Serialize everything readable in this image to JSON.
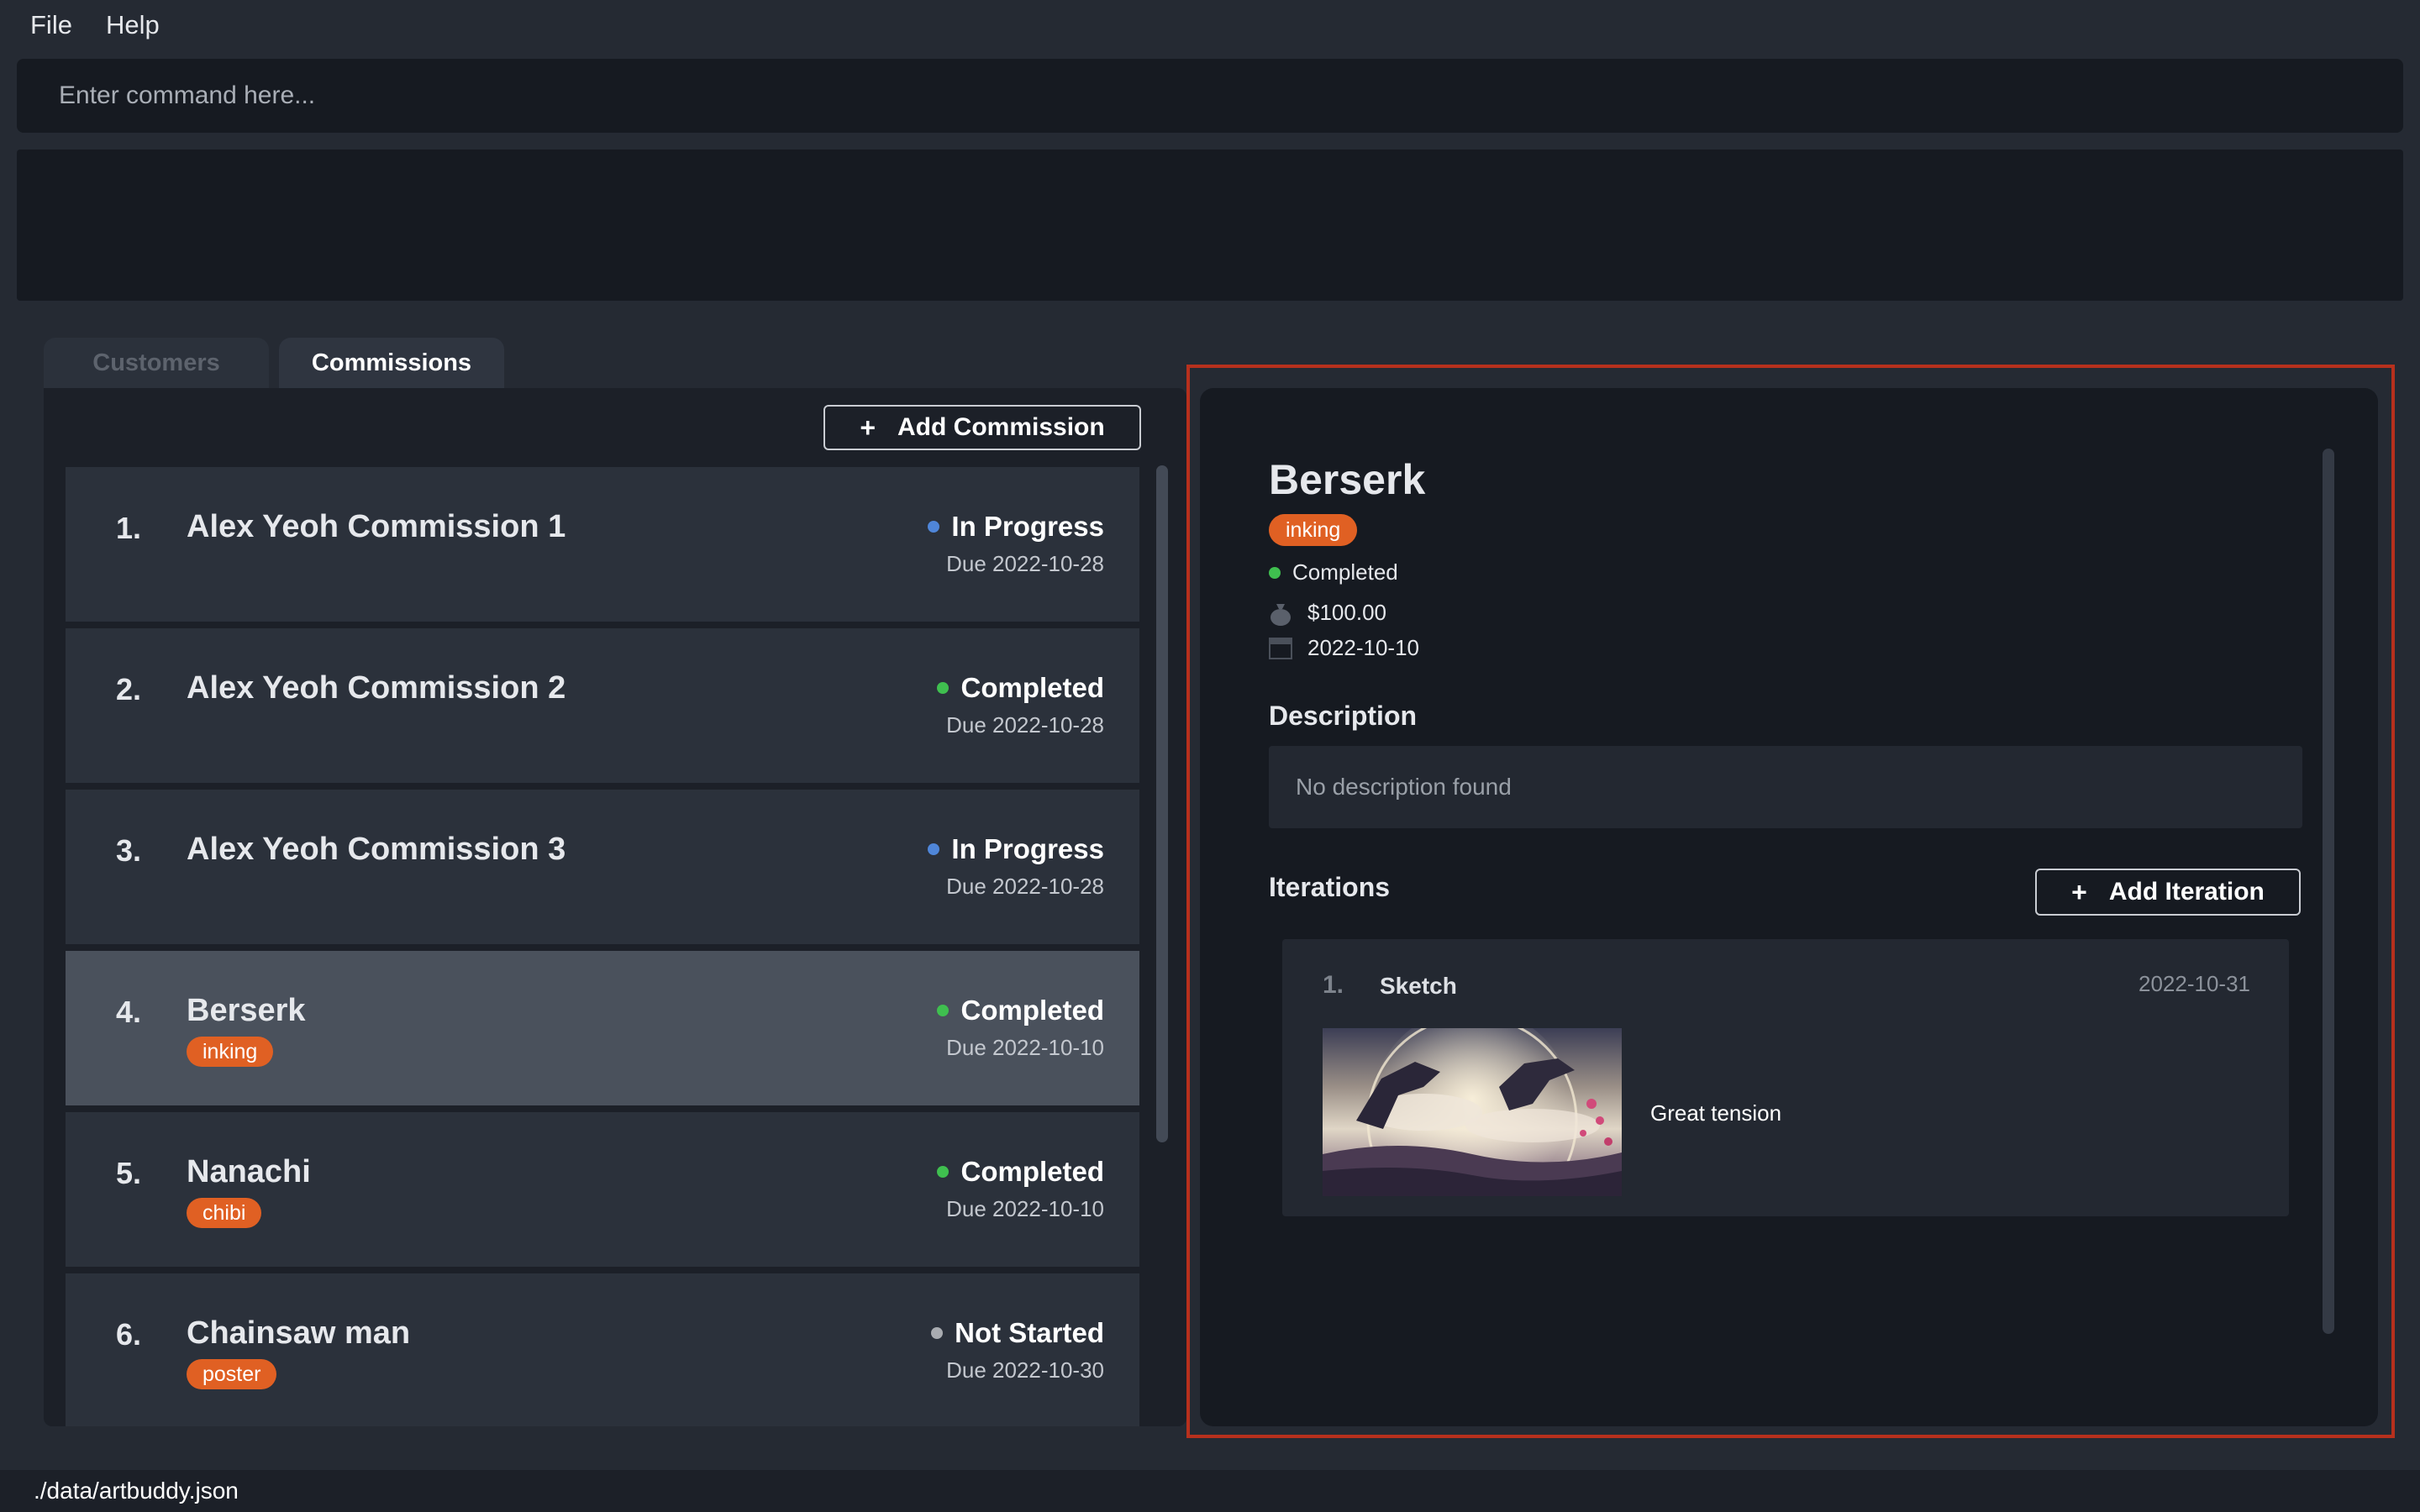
{
  "menu": {
    "file": "File",
    "help": "Help"
  },
  "command": {
    "placeholder": "Enter command here..."
  },
  "tabs": {
    "customers": "Customers",
    "commissions": "Commissions"
  },
  "list": {
    "add_button_label": "Add Commission",
    "add_button_icon": "+",
    "commissions": [
      {
        "index": "1.",
        "title": "Alex Yeoh Commission 1",
        "status": "In Progress",
        "status_color": "#4f86d9",
        "due": "Due 2022-10-28",
        "tag": ""
      },
      {
        "index": "2.",
        "title": "Alex Yeoh Commission 2",
        "status": "Completed",
        "status_color": "#3fbf4f",
        "due": "Due 2022-10-28",
        "tag": ""
      },
      {
        "index": "3.",
        "title": "Alex Yeoh Commission 3",
        "status": "In Progress",
        "status_color": "#4f86d9",
        "due": "Due 2022-10-28",
        "tag": ""
      },
      {
        "index": "4.",
        "title": "Berserk",
        "status": "Completed",
        "status_color": "#3fbf4f",
        "due": "Due 2022-10-10",
        "tag": "inking"
      },
      {
        "index": "5.",
        "title": "Nanachi",
        "status": "Completed",
        "status_color": "#3fbf4f",
        "due": "Due 2022-10-10",
        "tag": "chibi"
      },
      {
        "index": "6.",
        "title": "Chainsaw man",
        "status": "Not Started",
        "status_color": "#a9acb1",
        "due": "Due 2022-10-30",
        "tag": "poster"
      }
    ]
  },
  "detail": {
    "title": "Berserk",
    "tag": "inking",
    "status": "Completed",
    "status_color": "#3fbf4f",
    "fee": "$100.00",
    "fee_icon": "money-bag-icon",
    "deadline": "2022-10-10",
    "deadline_icon": "calendar-icon",
    "description_heading": "Description",
    "description": "No description found",
    "iterations_heading": "Iterations",
    "add_iteration_label": "Add Iteration",
    "add_iteration_icon": "+",
    "iterations": [
      {
        "index": "1.",
        "title": "Sketch",
        "date": "2022-10-31",
        "feedback": "Great tension"
      }
    ]
  },
  "statusbar": {
    "path": "./data/artbuddy.json"
  },
  "colors": {
    "accent_tag": "#e06023",
    "highlight_border": "#b7301d",
    "background": "#252a33"
  }
}
